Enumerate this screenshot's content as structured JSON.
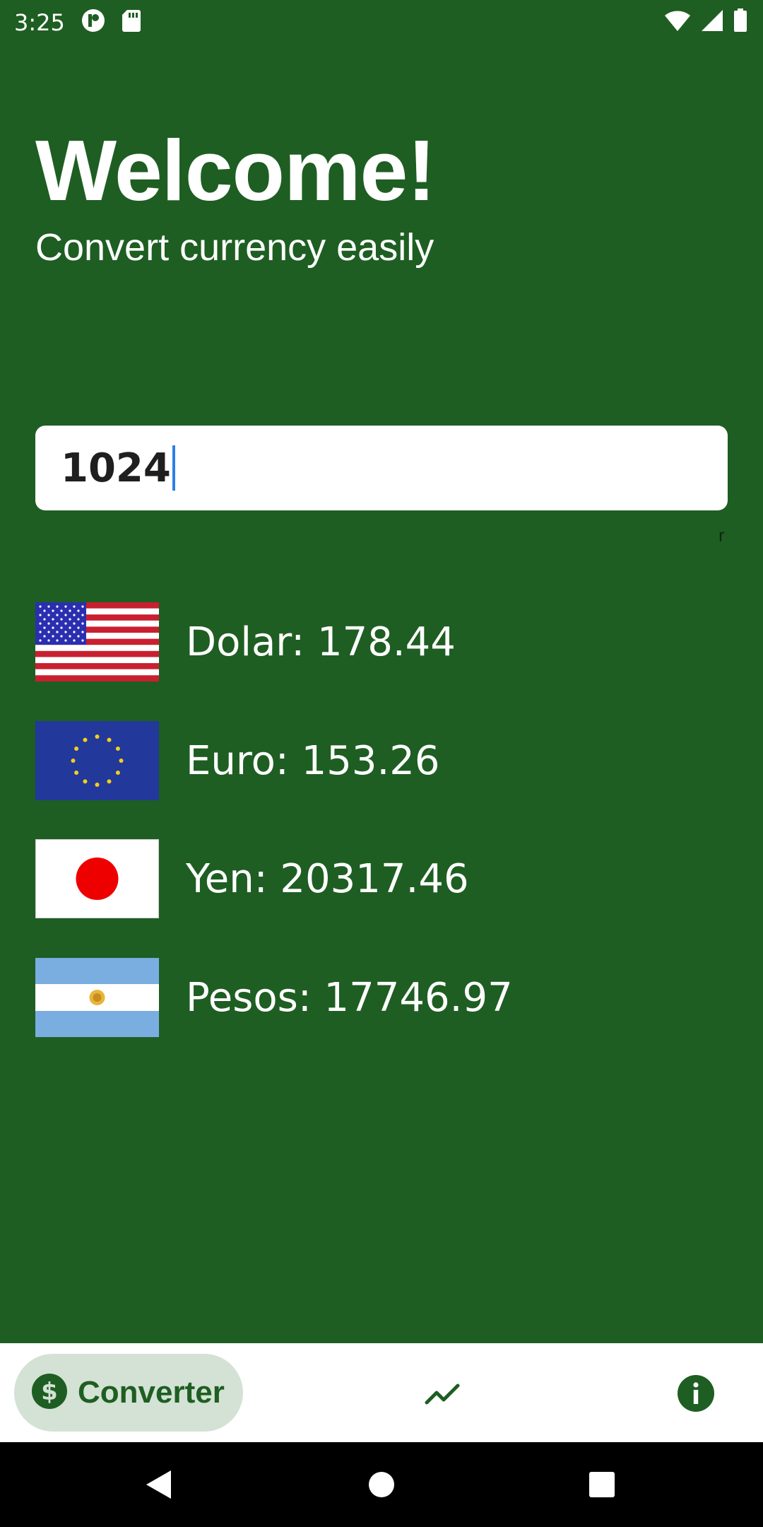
{
  "status_bar": {
    "time": "3:25",
    "icons": [
      "app-notification-icon",
      "sd-card-icon",
      "wifi-icon",
      "cell-signal-icon",
      "battery-icon"
    ]
  },
  "header": {
    "title": "Welcome!",
    "subtitle": "Convert currency easily"
  },
  "amount_input": {
    "value": "1024",
    "helper_text": "r"
  },
  "rates": [
    {
      "currency": "Dolar",
      "value": "178.44",
      "label": "Dolar: 178.44",
      "flag": "usa-flag-icon"
    },
    {
      "currency": "Euro",
      "value": "153.26",
      "label": "Euro: 153.26",
      "flag": "eu-flag-icon"
    },
    {
      "currency": "Yen",
      "value": "20317.46",
      "label": "Yen: 20317.46",
      "flag": "japan-flag-icon"
    },
    {
      "currency": "Pesos",
      "value": "17746.97",
      "label": "Pesos: 17746.97",
      "flag": "argentina-flag-icon"
    }
  ],
  "bottom_nav": {
    "items": [
      {
        "label": "Converter",
        "icon": "dollar-circle-icon",
        "selected": true
      },
      {
        "label": "",
        "icon": "trending-up-icon",
        "selected": false
      },
      {
        "label": "",
        "icon": "info-icon",
        "selected": false
      }
    ]
  },
  "colors": {
    "background": "#1e5e22",
    "nav_background": "#ffffff",
    "nav_selected_pill": "#d3e2d4",
    "accent": "#1e5e22",
    "caret": "#2f7fe6"
  }
}
